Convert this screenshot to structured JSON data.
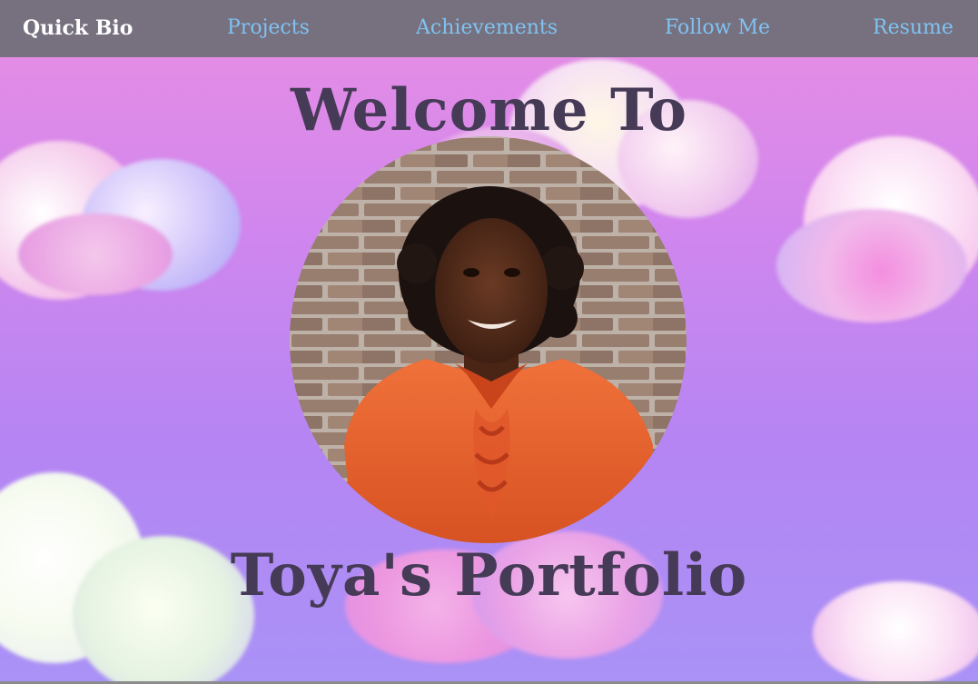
{
  "nav": {
    "brand": "Quick Bio",
    "projects": "Projects",
    "achievements": "Achievements",
    "follow": "Follow Me",
    "resume": "Resume"
  },
  "hero": {
    "welcome": "Welcome To",
    "portfolio": "Toya's Portfolio"
  },
  "colors": {
    "navbar_bg": "#76707f",
    "nav_link": "#7fc3f2",
    "heading": "#463b57"
  }
}
